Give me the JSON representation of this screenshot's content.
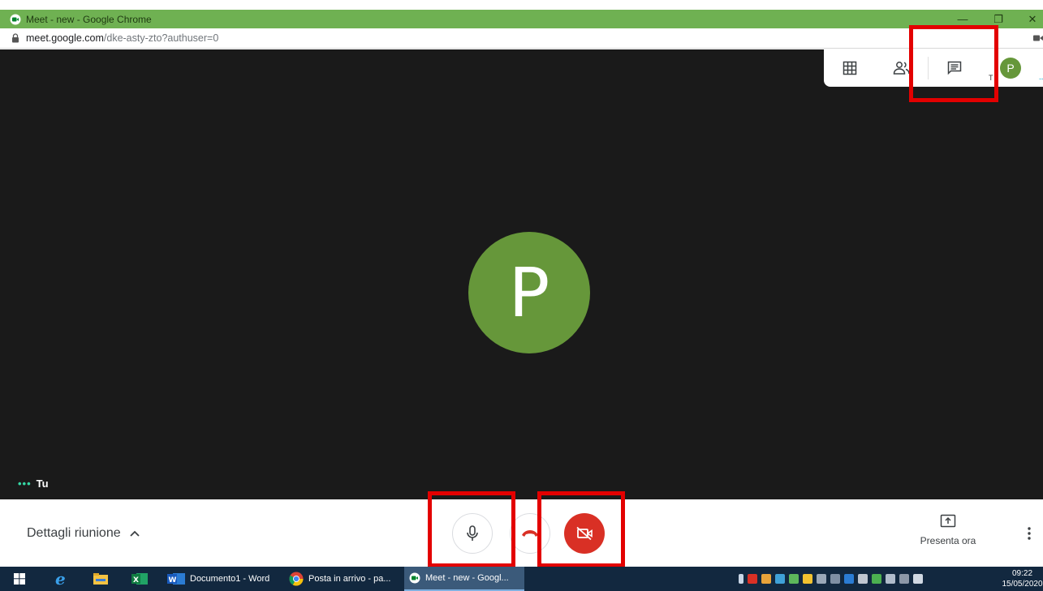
{
  "window": {
    "title": "Meet - new - Google Chrome",
    "minimize_glyph": "—",
    "restore_glyph": "❐",
    "close_glyph": "✕"
  },
  "address": {
    "host": "meet.google.com",
    "path": "/dke-asty-zto?authuser=0"
  },
  "top_panel": {
    "grid_icon": "grid-layout-icon",
    "people_icon": "people-icon",
    "chat_icon": "chat-icon",
    "avatar_letter": "P",
    "small_t": "T",
    "more_dots": "..."
  },
  "stage": {
    "avatar_letter": "P",
    "self_dots": "•••",
    "self_label": "Tu",
    "avatar_color": "#66973a"
  },
  "controls": {
    "details_label": "Dettagli riunione",
    "details_chevron": "^",
    "present_label": "Presenta ora",
    "mic_icon": "microphone-icon",
    "hangup_icon": "hangup-icon",
    "camera_off_icon": "camera-off-icon",
    "camera_off_color": "#d93025"
  },
  "highlight_color": "#e30000",
  "taskbar": {
    "word_label": "Documento1 - Word",
    "mail_label": "Posta in arrivo - pa...",
    "meet_label": "Meet - new - Googl...",
    "time": "09:22",
    "date": "15/05/2020"
  }
}
